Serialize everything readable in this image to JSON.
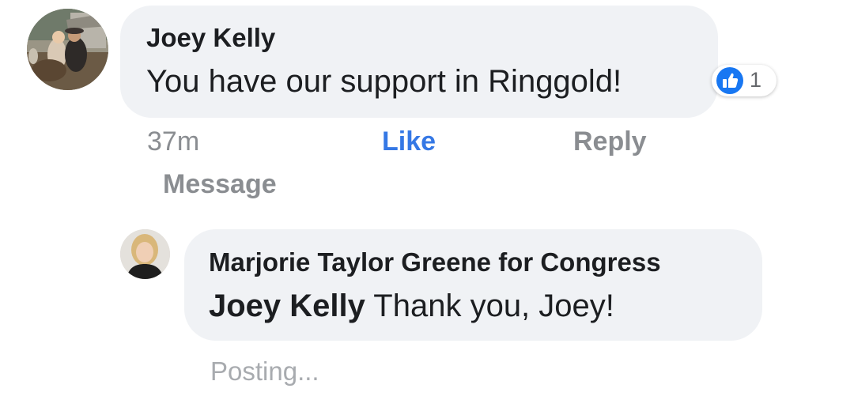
{
  "comment": {
    "author": "Joey Kelly",
    "text": "You have our support in Ringgold!",
    "reaction": {
      "icon": "thumbs-up-icon",
      "count": "1",
      "color": "#1877f2"
    },
    "actions": {
      "time": "37m",
      "like": "Like",
      "reply": "Reply",
      "message": "Message"
    }
  },
  "reply": {
    "author": "Marjorie Taylor Greene for Congress",
    "mention": "Joey Kelly",
    "text": "Thank you, Joey!",
    "status": "Posting..."
  },
  "colors": {
    "bubble": "#f0f2f5",
    "like_active": "#3578e5",
    "muted": "#8a8d91"
  }
}
